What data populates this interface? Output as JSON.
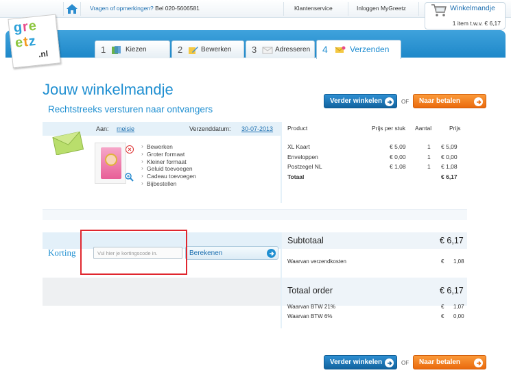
{
  "topbar": {
    "question": "Vragen of opmerkingen?",
    "phone": "Bel 020-5606581",
    "customer_service": "Klantenservice",
    "login": "Inloggen MyGreetz",
    "cart_title": "Winkelmandje",
    "cart_info": "1 item t.w.v. € 6,17"
  },
  "logo": {
    "line1": "gre",
    "line2": "etz",
    "tld": ".nl"
  },
  "tabs": [
    {
      "num": "1",
      "label": "Kiezen",
      "icon": "cards-icon",
      "active": false
    },
    {
      "num": "2",
      "label": "Bewerken",
      "icon": "pencil-icon",
      "active": false
    },
    {
      "num": "3",
      "label": "Adresseren",
      "icon": "envelope-icon",
      "active": false
    },
    {
      "num": "4",
      "label": "Verzenden",
      "icon": "send-icon",
      "active": true
    }
  ],
  "page": {
    "title": "Jouw winkelmandje",
    "subtitle": "Rechtstreeks versturen naar ontvangers"
  },
  "buttons": {
    "continue_shopping": "Verder winkelen",
    "or": "OF",
    "checkout": "Naar betalen"
  },
  "order": {
    "to_label": "Aan:",
    "recipient": "meisie",
    "ship_date_label": "Verzenddatum:",
    "ship_date": "30-07-2013",
    "actions": [
      "Bewerken",
      "Groter formaat",
      "Kleiner formaat",
      "Geluid toevoegen",
      "Cadeau toevoegen",
      "Bijbestellen"
    ],
    "columns": {
      "product": "Product",
      "unit_price": "Prijs per stuk",
      "quantity": "Aantal",
      "price": "Prijs"
    },
    "items": [
      {
        "product": "XL Kaart",
        "unit_price": "€ 5,09",
        "quantity": "1",
        "price": "€ 5,09"
      },
      {
        "product": "Enveloppen",
        "unit_price": "€ 0,00",
        "quantity": "1",
        "price": "€ 0,00"
      },
      {
        "product": "Postzegel NL",
        "unit_price": "€ 1,08",
        "quantity": "1",
        "price": "€ 1,08"
      }
    ],
    "total_label": "Totaal",
    "total": "€ 6,17"
  },
  "discount": {
    "label": "Korting",
    "placeholder": "Vul hier je kortingscode in.",
    "calculate": "Berekenen"
  },
  "totals": {
    "subtotal_label": "Subtotaal",
    "subtotal": "€ 6,17",
    "shipping_label": "Waarvan verzendkosten",
    "shipping_currency": "€",
    "shipping": "1,08",
    "order_total_label": "Totaal order",
    "order_total": "€ 6,17",
    "vat21_label": "Waarvan BTW 21%",
    "vat21_currency": "€",
    "vat21": "1,07",
    "vat6_label": "Waarvan BTW 6%",
    "vat6_currency": "€",
    "vat6": "0,00"
  },
  "colors": {
    "brand_blue": "#1f8fd1",
    "checkout_orange": "#ea6a0d",
    "button_blue": "#12639f",
    "highlight_red": "#e0262e"
  }
}
